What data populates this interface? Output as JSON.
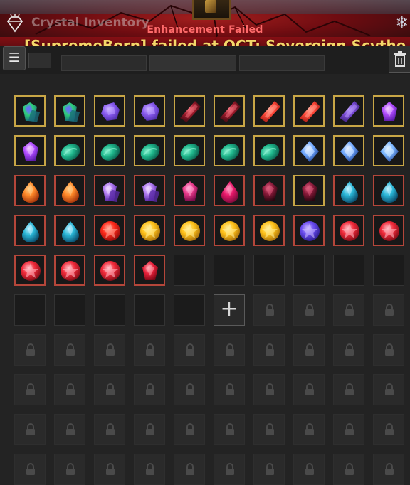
{
  "window": {
    "title": "Crystal Inventory"
  },
  "notification": {
    "subtitle": "Enhancement Failed",
    "message": "[SupremeBorn] failed at  OCT: Sovereign Scythe."
  },
  "toolbar": {
    "menu_icon": "hamburger-menu-icon",
    "trash_icon": "trash-icon"
  },
  "colors": {
    "notif_subtitle": "#ff6b6b",
    "notif_message": "#f5d86a",
    "slot_bg": "#1b1b1b"
  },
  "inventory": {
    "columns": 10,
    "rows": [
      [
        {
          "gem": "emerald-sapphire-cluster",
          "border": "#c8a646"
        },
        {
          "gem": "emerald-sapphire-cluster",
          "border": "#c8a646"
        },
        {
          "gem": "purple-hexagon",
          "border": "#c8a646"
        },
        {
          "gem": "purple-hexagon",
          "border": "#c8a646"
        },
        {
          "gem": "dark-ruby-shards",
          "border": "#c8a646"
        },
        {
          "gem": "dark-ruby-shards",
          "border": "#c8a646"
        },
        {
          "gem": "red-shard",
          "border": "#c8a646"
        },
        {
          "gem": "red-shard",
          "border": "#c8a646"
        },
        {
          "gem": "violet-shard",
          "border": "#c8a646"
        },
        {
          "gem": "violet-crystal-glow",
          "border": "#c8a646"
        }
      ],
      [
        {
          "gem": "violet-crystal-glow",
          "border": "#c8a646"
        },
        {
          "gem": "teal-stone",
          "border": "#c8a646"
        },
        {
          "gem": "teal-stone",
          "border": "#c8a646"
        },
        {
          "gem": "teal-stone",
          "border": "#c8a646"
        },
        {
          "gem": "teal-stone",
          "border": "#c8a646"
        },
        {
          "gem": "teal-stone",
          "border": "#c8a646"
        },
        {
          "gem": "teal-stone",
          "border": "#c8a646"
        },
        {
          "gem": "blue-star-diamond",
          "border": "#c8a646"
        },
        {
          "gem": "blue-star-diamond",
          "border": "#c8a646"
        },
        {
          "gem": "blue-diamond-large",
          "border": "#c8a646"
        }
      ],
      [
        {
          "gem": "orange-teardrop",
          "border": "#b4463a"
        },
        {
          "gem": "orange-teardrop",
          "border": "#b4463a"
        },
        {
          "gem": "amethyst-cluster",
          "border": "#b4463a"
        },
        {
          "gem": "amethyst-cluster",
          "border": "#b4463a"
        },
        {
          "gem": "magenta-crystal",
          "border": "#b4463a"
        },
        {
          "gem": "magenta-teardrop",
          "border": "#b4463a"
        },
        {
          "gem": "dark-ruby-gem",
          "border": "#b4463a"
        },
        {
          "gem": "dark-ruby-gem",
          "border": "#c8a646"
        },
        {
          "gem": "cyan-teardrop",
          "border": "#b4463a"
        },
        {
          "gem": "cyan-teardrop",
          "border": "#b4463a"
        }
      ],
      [
        {
          "gem": "cyan-teardrop",
          "border": "#b4463a"
        },
        {
          "gem": "cyan-teardrop",
          "border": "#b4463a"
        },
        {
          "gem": "red-orb",
          "border": "#b4463a"
        },
        {
          "gem": "gold-orb",
          "border": "#b4463a"
        },
        {
          "gem": "gold-orb",
          "border": "#b4463a"
        },
        {
          "gem": "gold-orb",
          "border": "#b4463a"
        },
        {
          "gem": "gold-orb",
          "border": "#b4463a"
        },
        {
          "gem": "purple-orb",
          "border": "#b4463a"
        },
        {
          "gem": "red-star-orb",
          "border": "#b4463a"
        },
        {
          "gem": "red-star-orb",
          "border": "#b4463a"
        }
      ],
      [
        {
          "gem": "red-star-orb",
          "border": "#b4463a"
        },
        {
          "gem": "red-star-orb",
          "border": "#b4463a"
        },
        {
          "gem": "red-star-orb",
          "border": "#b4463a"
        },
        {
          "gem": "ruby-pendant",
          "border": "#b4463a"
        },
        {
          "empty": true
        },
        {
          "empty": true
        },
        {
          "empty": true
        },
        {
          "empty": true
        },
        {
          "empty": true
        },
        {
          "empty": true
        }
      ],
      [
        {
          "empty": true
        },
        {
          "empty": true
        },
        {
          "empty": true
        },
        {
          "empty": true
        },
        {
          "empty": true
        },
        {
          "add": true,
          "label": "+"
        },
        {
          "locked": true
        },
        {
          "locked": true
        },
        {
          "locked": true
        },
        {
          "locked": true
        }
      ]
    ],
    "locked_rows": 4
  }
}
